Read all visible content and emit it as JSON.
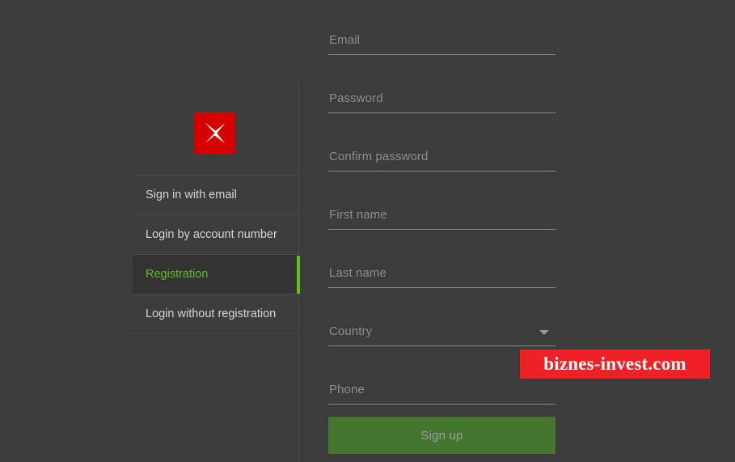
{
  "theme": {
    "background": "#3c3c3c",
    "panel_active_bg": "#333333",
    "accent_green": "#5fbd28",
    "button_green": "#44762f",
    "logo_red": "#d60000",
    "watermark_red": "#ef2127",
    "divider": "#4a4a4a",
    "placeholder_text": "#8e8e8e",
    "menu_text": "#d6d6d6"
  },
  "auth_panel": {
    "logo_icon": "red-x-star-logo-icon",
    "menu_items": [
      {
        "label": "Sign in with email",
        "active": false
      },
      {
        "label": "Login by account number",
        "active": false
      },
      {
        "label": "Registration",
        "active": true
      },
      {
        "label": "Login without registration",
        "active": false
      }
    ]
  },
  "registration_form": {
    "fields": [
      {
        "name": "email",
        "label": "Email",
        "value": "",
        "type": "text"
      },
      {
        "name": "password",
        "label": "Password",
        "value": "",
        "type": "password"
      },
      {
        "name": "confirm-password",
        "label": "Confirm password",
        "value": "",
        "type": "password"
      },
      {
        "name": "first-name",
        "label": "First name",
        "value": "",
        "type": "text"
      },
      {
        "name": "last-name",
        "label": "Last name",
        "value": "",
        "type": "text"
      },
      {
        "name": "country",
        "label": "Country",
        "value": "",
        "type": "select",
        "icon": "chevron-down-icon"
      },
      {
        "name": "phone",
        "label": "Phone",
        "value": "",
        "type": "text"
      }
    ],
    "submit_label": "Sign up"
  },
  "watermark": {
    "text": "biznes-invest.com"
  }
}
